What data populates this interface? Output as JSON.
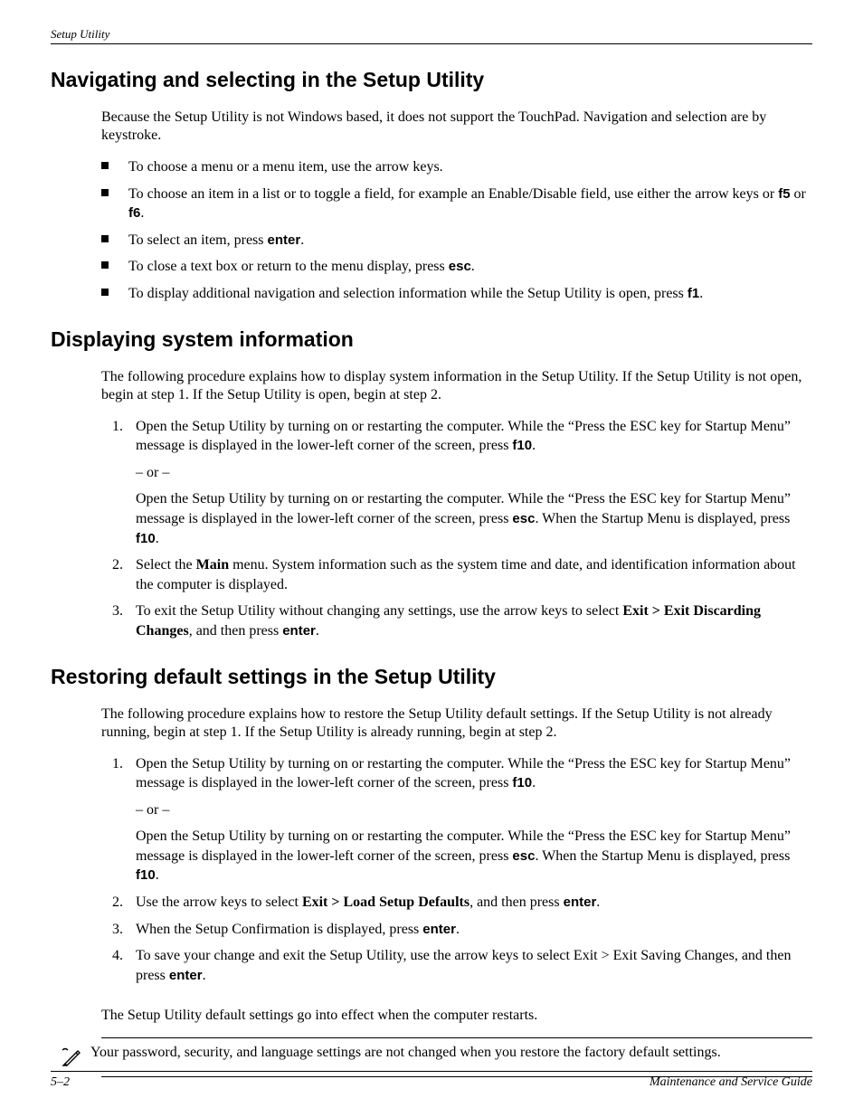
{
  "header": {
    "running": "Setup Utility"
  },
  "sections": {
    "nav": {
      "title": "Navigating and selecting in the Setup Utility",
      "intro": "Because the Setup Utility is not Windows based, it does not support the TouchPad. Navigation and selection are by keystroke.",
      "bullets": {
        "b1": "To choose a menu or a menu item, use the arrow keys.",
        "b2a": "To choose an item in a list or to toggle a field, for example an Enable/Disable field, use either the arrow keys or ",
        "b2_f5": "f5",
        "b2_or": " or ",
        "b2_f6": "f6",
        "b2_dot": ".",
        "b3a": "To select an item, press ",
        "b3_enter": "enter",
        "b3_dot": ".",
        "b4a": "To close a text box or return to the menu display, press ",
        "b4_esc": "esc",
        "b4_dot": ".",
        "b5a": "To display additional navigation and selection information while the Setup Utility is open, press ",
        "b5_f1": "f1",
        "b5_dot": "."
      }
    },
    "sys": {
      "title": "Displaying system information",
      "intro": "The following procedure explains how to display system information in the Setup Utility. If the Setup Utility is not open, begin at step 1. If the Setup Utility is open, begin at step 2.",
      "ol": {
        "i1a": "Open the Setup Utility by turning on or restarting the computer. While the “Press the ESC key for Startup Menu” message is displayed in the lower-left corner of the screen, press ",
        "i1_f10": "f10",
        "i1_dot": ".",
        "or": "– or –",
        "i1b_a": "Open the Setup Utility by turning on or restarting the computer. While the “Press the ESC key for Startup Menu” message is displayed in the lower-left corner of the screen, press ",
        "i1b_esc": "esc",
        "i1b_b": ". When the Startup Menu is displayed, press ",
        "i1b_f10": "f10",
        "i1b_dot": ".",
        "i2a": "Select the ",
        "i2_main": "Main",
        "i2b": " menu. System information such as the system time and date, and identification information about the computer is displayed.",
        "i3a": "To exit the Setup Utility without changing any settings, use the arrow keys to select ",
        "i3_exit": "Exit > Exit Discarding Changes",
        "i3b": ", and then press ",
        "i3_enter": "enter",
        "i3_dot": "."
      }
    },
    "restore": {
      "title": "Restoring default settings in the Setup Utility",
      "intro": "The following procedure explains how to restore the Setup Utility default settings. If the Setup Utility is not already running, begin at step 1. If the Setup Utility is already running, begin at step 2.",
      "ol": {
        "i1a": "Open the Setup Utility by turning on or restarting the computer. While the “Press the ESC key for Startup Menu” message is displayed in the lower-left corner of the screen, press ",
        "i1_f10": "f10",
        "i1_dot": ".",
        "or": "– or –",
        "i1b_a": "Open the Setup Utility by turning on or restarting the computer. While the “Press the ESC key for Startup Menu” message is displayed in the lower-left corner of the screen, press ",
        "i1b_esc": "esc",
        "i1b_b": ". When the Startup Menu is displayed, press ",
        "i1b_f10": "f10",
        "i1b_dot": ".",
        "i2a": "Use the arrow keys to select ",
        "i2_load": "Exit > Load Setup Defaults",
        "i2b": ", and then press ",
        "i2_enter": "enter",
        "i2_dot": ".",
        "i3a": "When the Setup Confirmation is displayed, press ",
        "i3_enter": "enter",
        "i3_dot": ".",
        "i4a": "To save your change and exit the Setup Utility, use the arrow keys to select Exit > Exit Saving Changes, and then press ",
        "i4_enter": "enter",
        "i4_dot": "."
      },
      "concl": "The Setup Utility default settings go into effect when the computer restarts.",
      "note": "Your password, security, and language settings are not changed when you restore the factory default settings."
    }
  },
  "footer": {
    "left": "5–2",
    "right": "Maintenance and Service Guide"
  }
}
